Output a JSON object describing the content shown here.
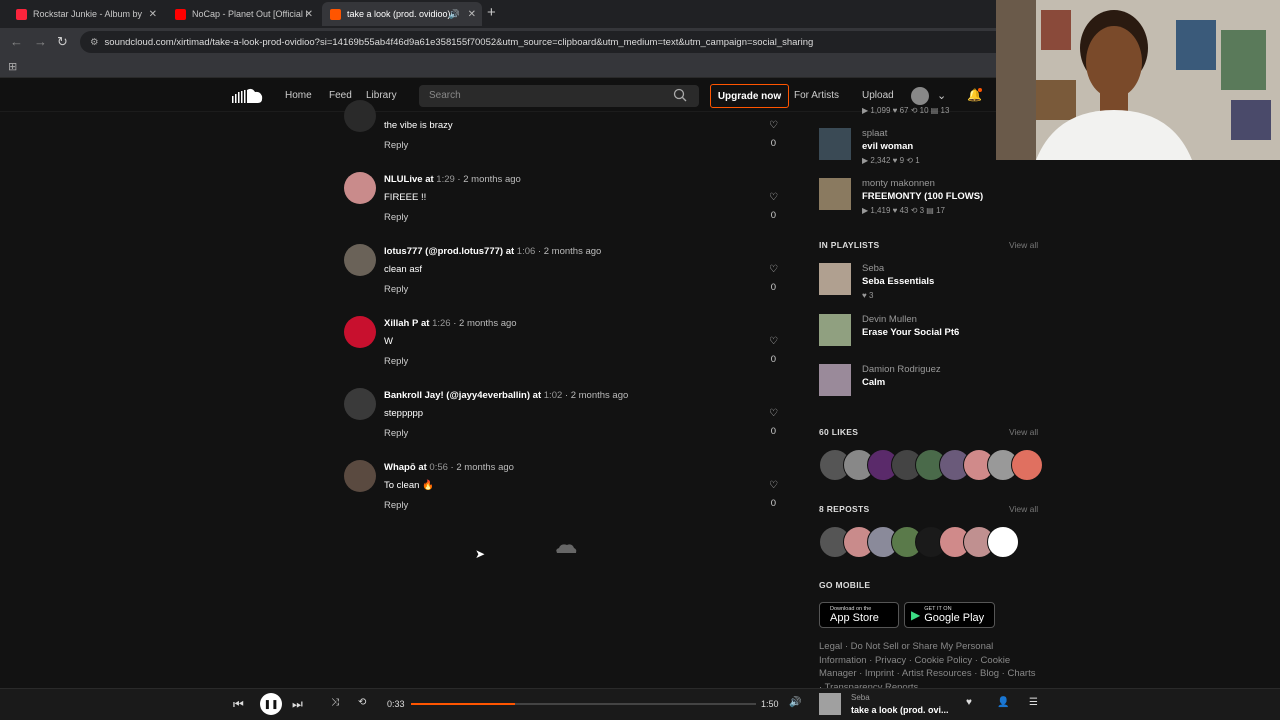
{
  "browser": {
    "tabs": [
      {
        "label": "Rockstar Junkie - Album by",
        "fav_color": "#fa243c"
      },
      {
        "label": "NoCap - Planet Out [Official M",
        "fav_color": "#ff0000"
      },
      {
        "label": "take a look (prod. ovidioo) |",
        "fav_color": "#ff5500"
      }
    ],
    "url": "soundcloud.com/xirtimad/take-a-look-prod-ovidioo?si=14169b55ab4f46d9a61e358155f70052&utm_source=clipboard&utm_medium=text&utm_campaign=social_sharing"
  },
  "header": {
    "nav": [
      "Home",
      "Feed",
      "Library"
    ],
    "search_placeholder": "Search",
    "upgrade_label": "Upgrade now",
    "for_artists": "For Artists",
    "upload": "Upload"
  },
  "comments": [
    {
      "user": "",
      "at": "",
      "time": "",
      "text": "the vibe is brazy",
      "likes": "0",
      "color": "#2a2a2a"
    },
    {
      "user": "NLULive",
      "at": "1:29",
      "time": "2 months ago",
      "text": "FIREEE !!",
      "likes": "0",
      "color": "#c98b8b"
    },
    {
      "user": "lotus777 (@prod.lotus777)",
      "at": "1:06",
      "time": "2 months ago",
      "text": "clean asf",
      "likes": "0",
      "color": "#6a6258"
    },
    {
      "user": "Xillah P",
      "at": "1:26",
      "time": "2 months ago",
      "text": "W",
      "likes": "0",
      "color": "#c8102e"
    },
    {
      "user": "Bankroll Jay! (@jayy4everballin)",
      "at": "1:02",
      "time": "2 months ago",
      "text": "steppppp",
      "likes": "0",
      "color": "#3a3a3a"
    },
    {
      "user": "Whapō",
      "at": "0:56",
      "time": "2 months ago",
      "text": "To clean 🔥",
      "likes": "0",
      "color": "#5a4a40"
    }
  ],
  "reply_label": "Reply",
  "at_word": "at",
  "related": [
    {
      "artist": "splaat",
      "title": "evil woman",
      "stats": "▶ 2,342  ♥ 9  ⟲ 1",
      "color": "#3a4a55"
    },
    {
      "artist": "monty makonnen",
      "title": "FREEMONTY (100 FLOWS)",
      "stats": "▶ 1,419  ♥ 43  ⟲ 3  ▤ 17",
      "color": "#8a7a60"
    }
  ],
  "partial_stats": "▶ 1,099  ♥ 67  ⟲ 10  ▤ 13",
  "playlists_title": "IN PLAYLISTS",
  "playlists": [
    {
      "artist": "Seba",
      "title": "Seba Essentials",
      "stats": "♥ 3",
      "color": "#b0a090"
    },
    {
      "artist": "Devin Mullen",
      "title": "Erase Your Social Pt6",
      "stats": "",
      "color": "#90a080"
    },
    {
      "artist": "Damion Rodriguez",
      "title": "Calm",
      "stats": "",
      "color": "#9a8a9a"
    }
  ],
  "likes_title": "60 LIKES",
  "reposts_title": "8 REPOSTS",
  "view_all": "View all",
  "like_avatars": [
    "#555",
    "#888",
    "#5a2a6a",
    "#444",
    "#4a6a4a",
    "#6a5a7a",
    "#d08a8a",
    "#999",
    "#e07060"
  ],
  "repost_avatars": [
    "#555",
    "#c98b8b",
    "#8a8a9a",
    "#5a7a4a",
    "#1a1a1a",
    "#d08a8a",
    "#c09090",
    "#ffffff"
  ],
  "go_mobile": "GO MOBILE",
  "app_store": {
    "small": "Download on the",
    "big": "App Store"
  },
  "google_play": {
    "small": "GET IT ON",
    "big": "Google Play"
  },
  "footer": "Legal · Do Not Sell or Share My Personal Information · Privacy · Cookie Policy · Cookie Manager · Imprint · Artist Resources · Blog · Charts · Transparency Reports",
  "player": {
    "elapsed": "0:33",
    "duration": "1:50",
    "progress_fraction": 0.3,
    "artist": "Seba",
    "title": "take a look (prod. ovi..."
  }
}
